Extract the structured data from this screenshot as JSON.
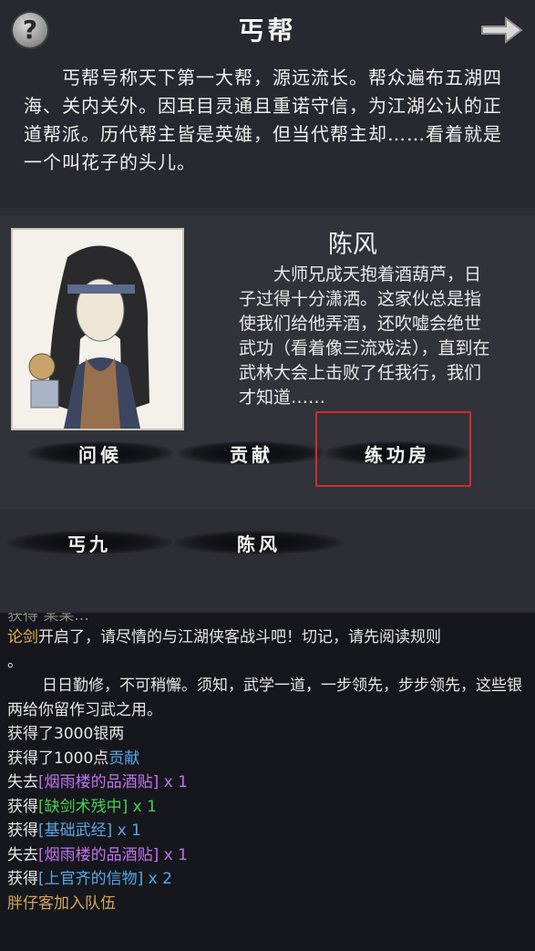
{
  "header": {
    "help_icon": "question-icon",
    "title": "丐帮",
    "next_icon": "arrow-right-icon",
    "description": "丐帮号称天下第一大帮，源远流长。帮众遍布五湖四海、关内关外。因耳目灵通且重诺守信，为江湖公认的正道帮派。历代帮主皆是英雄，但当代帮主却……看着就是一个叫花子的头儿。"
  },
  "character": {
    "name": "陈风",
    "bio": "大师兄成天抱着酒葫芦，日子过得十分潇洒。这家伙总是指使我们给他弄酒，还吹嘘会绝世武功（看着像三流戏法），直到在武林大会上击败了任我行，我们才知道……",
    "actions": [
      "问候",
      "贡献",
      "练功房"
    ]
  },
  "members": [
    "丐九",
    "陈风"
  ],
  "log": {
    "cut_line": "获得  某某...",
    "line1_highlight": "论剑",
    "line1_rest": "开启了，请尽情的与江湖侠客战斗吧！切记，请先阅读规则",
    "line1_tail": "。",
    "para": "日日勤修，不可稍懈。须知，武学一道，一步领先，步步领先，这些银两给你留作习武之用。",
    "silver": "获得了3000银两",
    "contrib_prefix": "获得了1000点",
    "contrib_word": "贡献",
    "lose1_prefix": "失去",
    "lose1_item": "[烟雨楼的品酒贴]",
    "lose1_qty": " x 1",
    "gain1_prefix": "获得",
    "gain1_item": "[缺剑术残中]",
    "gain1_qty": " x 1",
    "gain2_prefix": "获得",
    "gain2_item": "[基础武经]",
    "gain2_qty": " x 1",
    "lose2_prefix": "失去",
    "lose2_item": "[烟雨楼的品酒贴]",
    "lose2_qty": " x 1",
    "gain3_prefix": "获得",
    "gain3_item": "[上官齐的信物]",
    "gain3_qty": " x 2",
    "party": "胖仔客加入队伍"
  },
  "colors": {
    "highlight_box": "#d62a2a",
    "gold": "#e0b34a",
    "blue": "#5aa7e6",
    "purple": "#c171ee",
    "green": "#45d24e"
  }
}
